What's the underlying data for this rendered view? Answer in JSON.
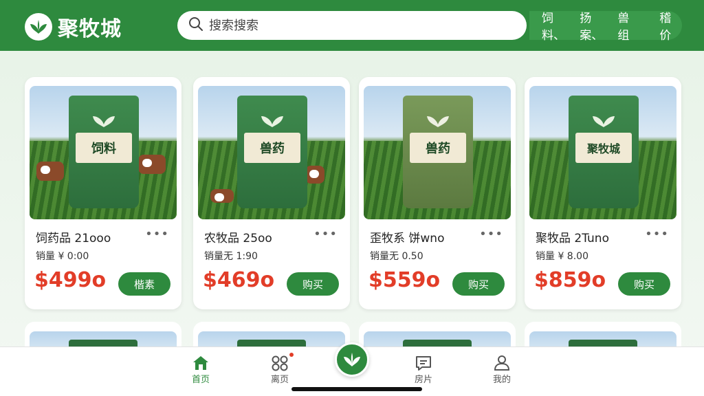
{
  "header": {
    "logo_text": "聚牧城",
    "search_placeholder": "搜索搜索",
    "categories": [
      "饲料、",
      "扬案、",
      "兽组",
      "稽价"
    ]
  },
  "products": [
    {
      "bag_label": "饲料",
      "title": "饲药品 21ooo",
      "sales": "销量 ¥ 0:00",
      "price": "$499o",
      "buy_label": "楷素"
    },
    {
      "bag_label": "兽药",
      "title": "农牧品 25oo",
      "sales": "销量无 1:90",
      "price": "$469o",
      "buy_label": "购买"
    },
    {
      "bag_label": "兽药",
      "title": "歪牧系 饼wno",
      "sales": "销量无 0.50",
      "price": "$559o",
      "buy_label": "购买"
    },
    {
      "bag_label": "聚牧城",
      "title": "聚牧品 2Tuno",
      "sales": "销量 ¥ 8.00",
      "price": "$859o",
      "buy_label": "购买"
    }
  ],
  "tabbar": {
    "items": [
      {
        "label": "首页",
        "icon": "home-icon"
      },
      {
        "label": "离页",
        "icon": "grid-icon"
      },
      {
        "label": "",
        "icon": "leaf-icon"
      },
      {
        "label": "房片",
        "icon": "message-icon"
      },
      {
        "label": "我的",
        "icon": "user-icon"
      }
    ]
  },
  "colors": {
    "brand_green": "#2e8a3e",
    "price_red": "#e23d28"
  }
}
